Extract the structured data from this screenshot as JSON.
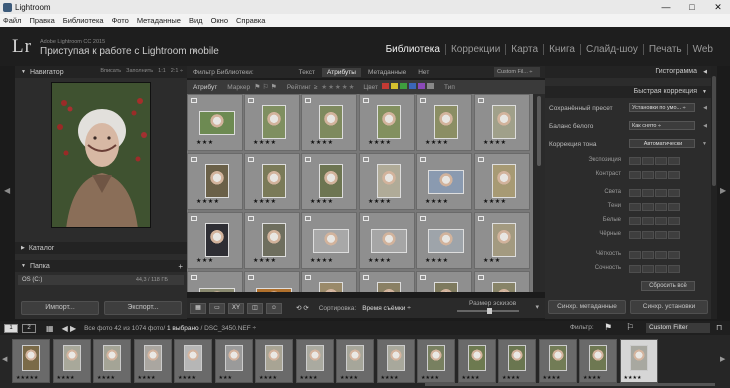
{
  "window": {
    "title": "Lightroom",
    "controls": {
      "minimize": "—",
      "maximize": "□",
      "close": "✕"
    }
  },
  "menu": [
    "Файл",
    "Правка",
    "Библиотека",
    "Фото",
    "Метаданные",
    "Вид",
    "Окно",
    "Справка"
  ],
  "identity": {
    "logo": "Lr",
    "subtitle": "Adobe Lightroom CC 2015",
    "title": "Приступая к работе с Lightroom mobile",
    "arrow": "▸"
  },
  "modules": [
    {
      "label": "Библиотека",
      "active": true
    },
    {
      "label": "Коррекции",
      "active": false
    },
    {
      "label": "Карта",
      "active": false
    },
    {
      "label": "Книга",
      "active": false
    },
    {
      "label": "Слайд-шоу",
      "active": false
    },
    {
      "label": "Печать",
      "active": false
    },
    {
      "label": "Web",
      "active": false
    }
  ],
  "left_panel": {
    "navigator": {
      "title": "Навигатор",
      "options": [
        "Вписать",
        "Заполнить",
        "1:1",
        "2:1 ÷"
      ]
    },
    "catalog": {
      "title": "Каталог"
    },
    "folders": {
      "title": "Папка",
      "add": "+"
    },
    "drive": {
      "label": "OS (C:)",
      "value": "44,3 / 118 ГБ"
    },
    "import_label": "Импорт...",
    "export_label": "Экспорт..."
  },
  "filter_bar": {
    "title": "Фильтр Библиотеки:",
    "tabs": [
      {
        "label": "Текст",
        "active": false
      },
      {
        "label": "Атрибуты",
        "active": true
      },
      {
        "label": "Метаданные",
        "active": false
      },
      {
        "label": "Нет",
        "active": false
      }
    ],
    "preset": "Custom Fil... ÷"
  },
  "attribute_bar": {
    "attribute_label": "Атрибут",
    "flag_label": "Маркер",
    "flags": "⚑ ⚐ ⚑",
    "rating_label": "Рейтинг",
    "rating_op": "≥",
    "stars": "★★★★★",
    "color_label": "Цвет",
    "type_label": "Тип",
    "colors": [
      "#c23a34",
      "#d7c12e",
      "#3e9e3e",
      "#3b66b8",
      "#8b49b8",
      "#888888"
    ]
  },
  "grid": {
    "rows": [
      [
        {
          "stars": "★★★",
          "orient": "land",
          "tone": "#6d8a52"
        },
        {
          "stars": "★★★★",
          "orient": "port",
          "tone": "#7f8f60"
        },
        {
          "stars": "★★★★",
          "orient": "port",
          "tone": "#7e8a5e"
        },
        {
          "stars": "★★★★",
          "orient": "port",
          "tone": "#82905f"
        },
        {
          "stars": "★★★★",
          "orient": "port",
          "tone": "#8b8e64"
        },
        {
          "stars": "★★★★",
          "orient": "port",
          "tone": "#a0a08a"
        }
      ],
      [
        {
          "stars": "★★★★",
          "orient": "port",
          "tone": "#6a6048"
        },
        {
          "stars": "★★★★",
          "orient": "port",
          "tone": "#7a7a58"
        },
        {
          "stars": "★★★★",
          "orient": "port",
          "tone": "#6d7552"
        },
        {
          "stars": "★★★★",
          "orient": "port",
          "tone": "#b0ab98"
        },
        {
          "stars": "★★★★",
          "orient": "land",
          "tone": "#8a9ab0"
        },
        {
          "stars": "★★★★",
          "orient": "port",
          "tone": "#a79a74"
        }
      ],
      [
        {
          "stars": "★★★",
          "orient": "port",
          "tone": "#2e2e34"
        },
        {
          "stars": "★★★★",
          "orient": "port",
          "tone": "#6e6e5e"
        },
        {
          "stars": "★★★★",
          "orient": "land",
          "tone": "#a8a8a8"
        },
        {
          "stars": "★★★★",
          "orient": "land",
          "tone": "#a6a6a6"
        },
        {
          "stars": "★★★★",
          "orient": "land",
          "tone": "#9ea4aa"
        },
        {
          "stars": "★★★",
          "orient": "port",
          "tone": "#a39a80"
        }
      ],
      [
        {
          "stars": "",
          "orient": "land",
          "tone": "#8a8a70"
        },
        {
          "stars": "",
          "orient": "land",
          "tone": "#b0702c"
        },
        {
          "stars": "",
          "orient": "port",
          "tone": "#9a8a6a"
        },
        {
          "stars": "",
          "orient": "port",
          "tone": "#8a8064"
        },
        {
          "stars": "",
          "orient": "port",
          "tone": "#7e7a5e"
        },
        {
          "stars": "",
          "orient": "port",
          "tone": "#888468"
        }
      ]
    ]
  },
  "toolbar": {
    "sort_label": "Сортировка:",
    "sort_value": "Время съёмки ÷",
    "thumb_size": "Размер эскизов",
    "arrow": "▾",
    "views": [
      "▦",
      "▭",
      "XY",
      "◫",
      "☺"
    ],
    "rotate": "⟲ ⟳"
  },
  "right_panel": {
    "histogram": "Гистограмма",
    "quick_develop": "Быстрая коррекция",
    "saved_preset": {
      "label": "Сохранённый пресет",
      "value": "Установки по умо... ÷"
    },
    "white_balance": {
      "label": "Баланс белого",
      "value": "Как снято ÷"
    },
    "tone": {
      "label": "Коррекция тона",
      "value": "Автоматически"
    },
    "sliders": [
      "Экспозиция",
      "Контраст",
      "Света",
      "Тени",
      "Белые",
      "Чёрные",
      "Чёткость",
      "Сочность"
    ],
    "reset": "Сбросить всё",
    "sync_metadata": "Синхр. метаданные",
    "sync_settings": "Синхр. установки"
  },
  "filmstrip_header": {
    "pages": [
      "1",
      "2"
    ],
    "nav": "◀ ▶",
    "grid_icon": "▦",
    "source": "Все фото",
    "count": "42 из 1074 фото/",
    "selected": "1 выбрано",
    "file": "/ DSC_3450.NEF ÷",
    "filter_label": "Фильтр:",
    "filter_value": "Custom Filter"
  },
  "filmstrip": [
    {
      "stars": "★★★★★",
      "tone": "#7a6a48",
      "selected": false
    },
    {
      "stars": "★★★★",
      "tone": "#a8a89a",
      "selected": false
    },
    {
      "stars": "★★★★",
      "tone": "#a4a496",
      "selected": false
    },
    {
      "stars": "★★★★",
      "tone": "#aaa6a0",
      "selected": false
    },
    {
      "stars": "★★★★",
      "tone": "#b6b6b6",
      "selected": false
    },
    {
      "stars": "★★★",
      "tone": "#9a9a9a",
      "selected": false
    },
    {
      "stars": "★★★★",
      "tone": "#a8a494",
      "selected": false
    },
    {
      "stars": "★★★★",
      "tone": "#aaaaa0",
      "selected": false
    },
    {
      "stars": "★★★★",
      "tone": "#a6a69a",
      "selected": false
    },
    {
      "stars": "★★★★",
      "tone": "#a8a89c",
      "selected": false
    },
    {
      "stars": "★★★★",
      "tone": "#788060",
      "selected": false
    },
    {
      "stars": "★★★★",
      "tone": "#6d7a50",
      "selected": false
    },
    {
      "stars": "★★★★",
      "tone": "#6a7650",
      "selected": false
    },
    {
      "stars": "★★★★",
      "tone": "#727c56",
      "selected": false
    },
    {
      "stars": "★★★★",
      "tone": "#6e7852",
      "selected": false
    },
    {
      "stars": "★★★★",
      "tone": "#a8a8a0",
      "selected": true
    }
  ]
}
